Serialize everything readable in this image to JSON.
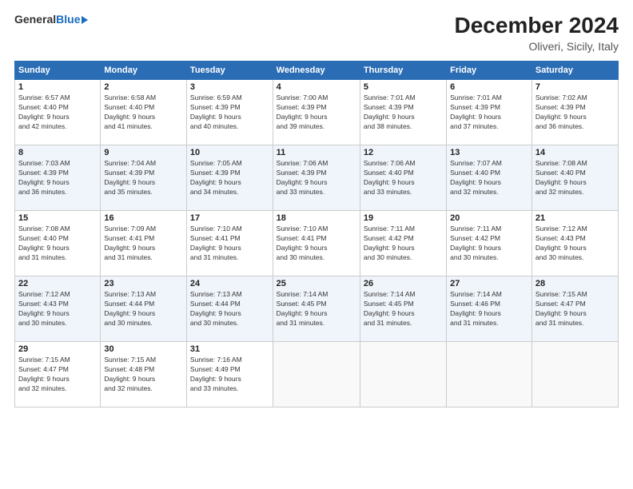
{
  "header": {
    "logo_general": "General",
    "logo_blue": "Blue",
    "main_title": "December 2024",
    "subtitle": "Oliveri, Sicily, Italy"
  },
  "calendar": {
    "columns": [
      "Sunday",
      "Monday",
      "Tuesday",
      "Wednesday",
      "Thursday",
      "Friday",
      "Saturday"
    ],
    "weeks": [
      [
        {
          "day": "",
          "info": ""
        },
        {
          "day": "2",
          "info": "Sunrise: 6:58 AM\nSunset: 4:40 PM\nDaylight: 9 hours\nand 41 minutes."
        },
        {
          "day": "3",
          "info": "Sunrise: 6:59 AM\nSunset: 4:39 PM\nDaylight: 9 hours\nand 40 minutes."
        },
        {
          "day": "4",
          "info": "Sunrise: 7:00 AM\nSunset: 4:39 PM\nDaylight: 9 hours\nand 39 minutes."
        },
        {
          "day": "5",
          "info": "Sunrise: 7:01 AM\nSunset: 4:39 PM\nDaylight: 9 hours\nand 38 minutes."
        },
        {
          "day": "6",
          "info": "Sunrise: 7:01 AM\nSunset: 4:39 PM\nDaylight: 9 hours\nand 37 minutes."
        },
        {
          "day": "7",
          "info": "Sunrise: 7:02 AM\nSunset: 4:39 PM\nDaylight: 9 hours\nand 36 minutes."
        }
      ],
      [
        {
          "day": "8",
          "info": "Sunrise: 7:03 AM\nSunset: 4:39 PM\nDaylight: 9 hours\nand 36 minutes."
        },
        {
          "day": "9",
          "info": "Sunrise: 7:04 AM\nSunset: 4:39 PM\nDaylight: 9 hours\nand 35 minutes."
        },
        {
          "day": "10",
          "info": "Sunrise: 7:05 AM\nSunset: 4:39 PM\nDaylight: 9 hours\nand 34 minutes."
        },
        {
          "day": "11",
          "info": "Sunrise: 7:06 AM\nSunset: 4:39 PM\nDaylight: 9 hours\nand 33 minutes."
        },
        {
          "day": "12",
          "info": "Sunrise: 7:06 AM\nSunset: 4:40 PM\nDaylight: 9 hours\nand 33 minutes."
        },
        {
          "day": "13",
          "info": "Sunrise: 7:07 AM\nSunset: 4:40 PM\nDaylight: 9 hours\nand 32 minutes."
        },
        {
          "day": "14",
          "info": "Sunrise: 7:08 AM\nSunset: 4:40 PM\nDaylight: 9 hours\nand 32 minutes."
        }
      ],
      [
        {
          "day": "15",
          "info": "Sunrise: 7:08 AM\nSunset: 4:40 PM\nDaylight: 9 hours\nand 31 minutes."
        },
        {
          "day": "16",
          "info": "Sunrise: 7:09 AM\nSunset: 4:41 PM\nDaylight: 9 hours\nand 31 minutes."
        },
        {
          "day": "17",
          "info": "Sunrise: 7:10 AM\nSunset: 4:41 PM\nDaylight: 9 hours\nand 31 minutes."
        },
        {
          "day": "18",
          "info": "Sunrise: 7:10 AM\nSunset: 4:41 PM\nDaylight: 9 hours\nand 30 minutes."
        },
        {
          "day": "19",
          "info": "Sunrise: 7:11 AM\nSunset: 4:42 PM\nDaylight: 9 hours\nand 30 minutes."
        },
        {
          "day": "20",
          "info": "Sunrise: 7:11 AM\nSunset: 4:42 PM\nDaylight: 9 hours\nand 30 minutes."
        },
        {
          "day": "21",
          "info": "Sunrise: 7:12 AM\nSunset: 4:43 PM\nDaylight: 9 hours\nand 30 minutes."
        }
      ],
      [
        {
          "day": "22",
          "info": "Sunrise: 7:12 AM\nSunset: 4:43 PM\nDaylight: 9 hours\nand 30 minutes."
        },
        {
          "day": "23",
          "info": "Sunrise: 7:13 AM\nSunset: 4:44 PM\nDaylight: 9 hours\nand 30 minutes."
        },
        {
          "day": "24",
          "info": "Sunrise: 7:13 AM\nSunset: 4:44 PM\nDaylight: 9 hours\nand 30 minutes."
        },
        {
          "day": "25",
          "info": "Sunrise: 7:14 AM\nSunset: 4:45 PM\nDaylight: 9 hours\nand 31 minutes."
        },
        {
          "day": "26",
          "info": "Sunrise: 7:14 AM\nSunset: 4:45 PM\nDaylight: 9 hours\nand 31 minutes."
        },
        {
          "day": "27",
          "info": "Sunrise: 7:14 AM\nSunset: 4:46 PM\nDaylight: 9 hours\nand 31 minutes."
        },
        {
          "day": "28",
          "info": "Sunrise: 7:15 AM\nSunset: 4:47 PM\nDaylight: 9 hours\nand 31 minutes."
        }
      ],
      [
        {
          "day": "29",
          "info": "Sunrise: 7:15 AM\nSunset: 4:47 PM\nDaylight: 9 hours\nand 32 minutes."
        },
        {
          "day": "30",
          "info": "Sunrise: 7:15 AM\nSunset: 4:48 PM\nDaylight: 9 hours\nand 32 minutes."
        },
        {
          "day": "31",
          "info": "Sunrise: 7:16 AM\nSunset: 4:49 PM\nDaylight: 9 hours\nand 33 minutes."
        },
        {
          "day": "",
          "info": ""
        },
        {
          "day": "",
          "info": ""
        },
        {
          "day": "",
          "info": ""
        },
        {
          "day": "",
          "info": ""
        }
      ]
    ],
    "week0_day1": {
      "day": "1",
      "info": "Sunrise: 6:57 AM\nSunset: 4:40 PM\nDaylight: 9 hours\nand 42 minutes."
    }
  }
}
